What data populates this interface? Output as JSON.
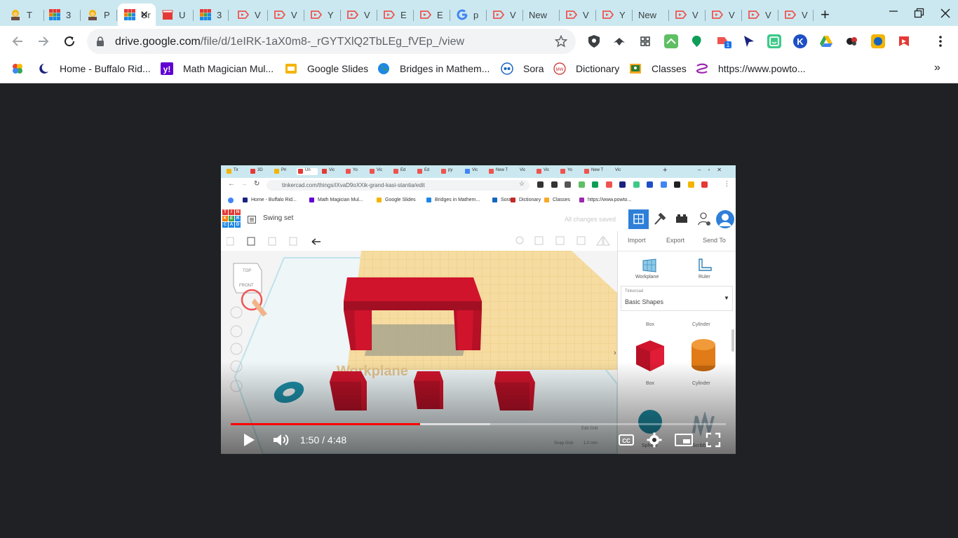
{
  "tabs": [
    {
      "label": "T",
      "favicon": "person-avatar",
      "color": "#f4b400"
    },
    {
      "label": "3",
      "favicon": "tinkercad",
      "color": "#e53935"
    },
    {
      "label": "P",
      "favicon": "person-avatar",
      "color": "#f4b400"
    },
    {
      "label": "Ur",
      "favicon": "tinkercad",
      "color": "#e53935",
      "active": true
    },
    {
      "label": "U",
      "favicon": "clapperboard",
      "color": "#e53935"
    },
    {
      "label": "3",
      "favicon": "tinkercad",
      "color": "#e53935"
    },
    {
      "label": "V",
      "favicon": "video-play",
      "color": "#ef5350"
    },
    {
      "label": "V",
      "favicon": "video-play",
      "color": "#ef5350"
    },
    {
      "label": "Y",
      "favicon": "video-play",
      "color": "#ef5350"
    },
    {
      "label": "V",
      "favicon": "video-play",
      "color": "#ef5350"
    },
    {
      "label": "E",
      "favicon": "video-play",
      "color": "#ef5350"
    },
    {
      "label": "E",
      "favicon": "video-play",
      "color": "#ef5350"
    },
    {
      "label": "p",
      "favicon": "google-g",
      "color": "#4285f4"
    },
    {
      "label": "V",
      "favicon": "video-play",
      "color": "#ef5350"
    },
    {
      "label": "New",
      "favicon": "",
      "color": ""
    },
    {
      "label": "V",
      "favicon": "video-play",
      "color": "#ef5350"
    },
    {
      "label": "Y",
      "favicon": "video-play",
      "color": "#ef5350"
    },
    {
      "label": "New",
      "favicon": "",
      "color": ""
    },
    {
      "label": "V",
      "favicon": "video-play",
      "color": "#ef5350"
    },
    {
      "label": "V",
      "favicon": "video-play",
      "color": "#ef5350"
    },
    {
      "label": "V",
      "favicon": "video-play",
      "color": "#ef5350"
    },
    {
      "label": "V",
      "favicon": "video-play",
      "color": "#ef5350"
    }
  ],
  "address": {
    "domain": "drive.google.com",
    "path": "/file/d/1eIRK-1aX0m8-_rGYTXlQ2TbLEg_fVEp_/view"
  },
  "bookmarks": [
    {
      "label": "",
      "icon": "google-photos-icon"
    },
    {
      "label": "Home - Buffalo Rid...",
      "icon": "moon-icon"
    },
    {
      "label": "Math Magician Mul...",
      "icon": "yahoo-icon"
    },
    {
      "label": "Google Slides",
      "icon": "slides-icon"
    },
    {
      "label": "Bridges in Mathem...",
      "icon": "globe-icon"
    },
    {
      "label": "Sora",
      "icon": "sora-icon"
    },
    {
      "label": "Dictionary",
      "icon": "mw-icon"
    },
    {
      "label": "Classes",
      "icon": "classroom-icon"
    },
    {
      "label": "https://www.powto...",
      "icon": "powtoon-icon"
    }
  ],
  "video": {
    "inner_url": "tinkercad.com/things/iXvaD9oXXik-grand-kasi-stantia/edit",
    "inner_bookmarks": [
      "Home - Buffalo Rid...",
      "Math Magician Mul...",
      "Google Slides",
      "Bridges in Mathem...",
      "Sora",
      "Dictionary",
      "Classes",
      "https://www.powto..."
    ],
    "inner_tabs": [
      "Tir",
      "3D",
      "Pri",
      "Un",
      "Vic",
      "Yo",
      "Vic",
      "Ed",
      "Ed",
      "py",
      "Vic",
      "New T",
      "Vic",
      "Vic",
      "Yo",
      "New T",
      "Vic"
    ],
    "design_title": "Swing set",
    "saved_status": "All changes saved",
    "panel_tabs": [
      "Import",
      "Export",
      "Send To"
    ],
    "panel_tools": [
      "Workplane",
      "Ruler"
    ],
    "shape_category_small": "Tinkercad",
    "shape_category": "Basic Shapes",
    "shapes": [
      "Box",
      "Cylinder",
      "Box",
      "Cylinder",
      "Sphere",
      "Scribble"
    ],
    "view_cube": [
      "TOP",
      "FRONT"
    ],
    "workplane_label": "Workplane",
    "edit_grid": "Edit Grid",
    "snap_grid": "Snap Grid",
    "snap_value": "1.0 mm",
    "time_current": "1:50",
    "time_total": "4:48",
    "time_display": "1:50 / 4:48",
    "progress": 0.3819,
    "buffered": 0.5241
  },
  "colors": {
    "tabstrip": "#cbe8f0",
    "video_bg": "#202124",
    "progress": "#ff0000",
    "shape_red": "#d0142c",
    "teal": "#1e8fa8",
    "orange": "#e07b18",
    "tinkercad_blue": "#2e7fd8"
  }
}
